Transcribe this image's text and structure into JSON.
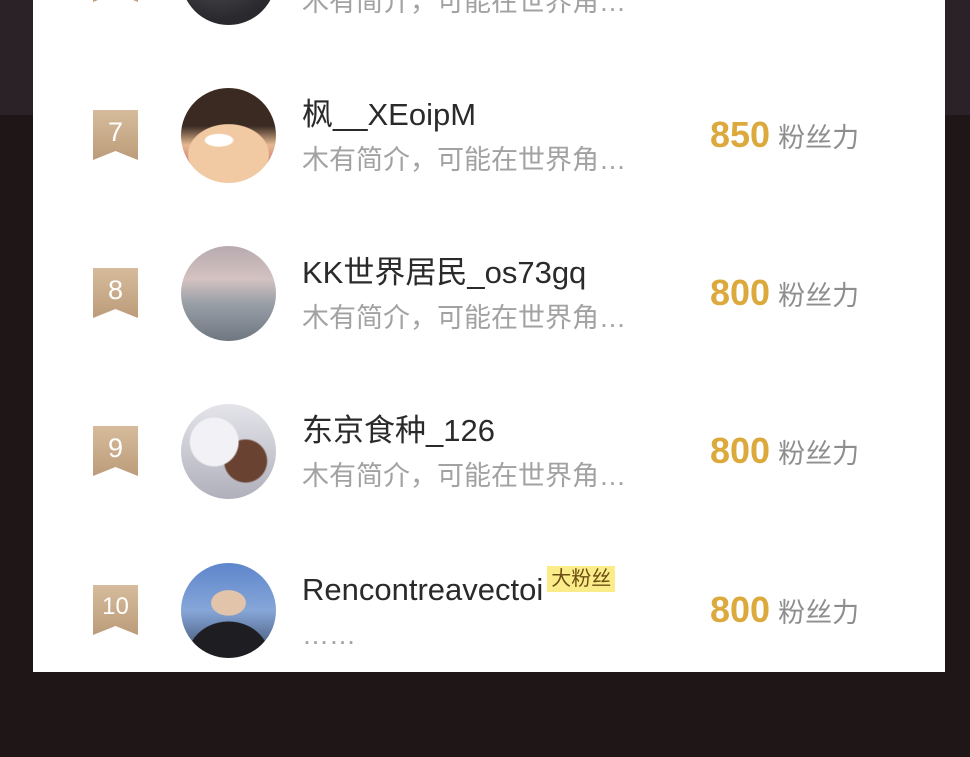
{
  "rows": [
    {
      "rank": "",
      "name": "",
      "intro": "木有简介，可能在世界角…",
      "value": "",
      "unit": ""
    },
    {
      "rank": "7",
      "name": "枫__XEoipM",
      "intro": "木有简介，可能在世界角…",
      "value": "850",
      "unit": "粉丝力"
    },
    {
      "rank": "8",
      "name": "KK世界居民_os73gq",
      "intro": "木有简介，可能在世界角…",
      "value": "800",
      "unit": "粉丝力"
    },
    {
      "rank": "9",
      "name": "东京食种_126",
      "intro": "木有简介，可能在世界角…",
      "value": "800",
      "unit": "粉丝力"
    },
    {
      "rank": "10",
      "name": "Rencontreavectoi",
      "tag": "大粉丝",
      "intro": "……",
      "value": "800",
      "unit": "粉丝力"
    }
  ],
  "colors": {
    "value": "#dca93d",
    "rank_badge": "#c9ab88",
    "fan_tag": "#fbec8a"
  }
}
